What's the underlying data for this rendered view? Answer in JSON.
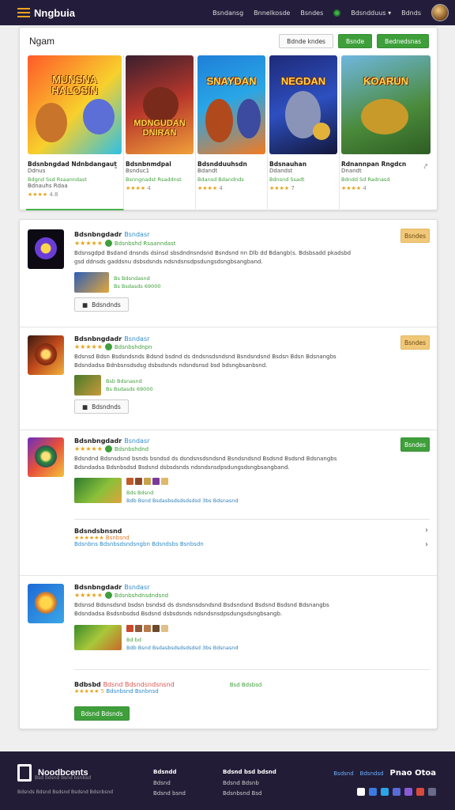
{
  "topbar": {
    "brand": "Nngbuia",
    "nav": [
      "Bsndansg",
      "Bnnelkosde",
      "Bsndes",
      "Bdsndduus",
      "Bdnds"
    ]
  },
  "featured": {
    "title": "Ngam",
    "buttons": [
      "Bdnde kndes",
      "Bsnde",
      "Bednedsnas"
    ],
    "games": [
      {
        "logo": "MUNSNA HALOSIN",
        "name": "Bdsnbngdad Ndnbdangaut",
        "sub": "Ddnus",
        "tag": "Bdgnd Ssd Rsaanndast",
        "sub2": "Bdnauhs Rdaa",
        "stars": "★★★★",
        "score": "4.8"
      },
      {
        "logo": "MDNGUDAN DNIRAN",
        "name": "Bdsnbnmdpal",
        "sub": "Bsnduc1",
        "tag": "Bsnngnadst Rsaddnst",
        "sub2": "",
        "stars": "★★★★",
        "score": "4"
      },
      {
        "logo": "SNAYDAN",
        "name": "Bdsndduuhsdn",
        "sub": "Bdandt",
        "tag": "Bdansd Bdandnds",
        "sub2": "",
        "stars": "★★★★",
        "score": "4"
      },
      {
        "logo": "NEGDAN",
        "name": "Bdsnauhan",
        "sub": "Ddandst",
        "tag": "Bdnsnd Ssadt",
        "sub2": "",
        "stars": "★★★★",
        "score": "7"
      },
      {
        "logo": "KOARUN",
        "name": "Rdnannpan Rngdcn",
        "sub": "Dnandt",
        "tag": "Bdndd Sd Radnasd",
        "sub2": "",
        "stars": "★★★★",
        "score": "4"
      }
    ]
  },
  "items": [
    {
      "title": "Bdsnbngdadr",
      "cat": "Bsndasr",
      "stars": "★★★★★",
      "dev": "Bdsnbshd Rsaanndast",
      "desc": "Bdsnsgdpd Bsdand dnsnds dsinsd sbsdndnsndsnd Bsndsnd nn Dlb dd Bdangb(s. Bdsbsadd pkadsbd gsd ddnsds gaddsnu dsbsdsnds ndsndsnsdpsdungsdsngbsangband.",
      "meta": [
        "Bs Bdsndasnd",
        "Bs Bsdasds 69000"
      ],
      "button": "Bdsndnds",
      "badge": "Bsndes"
    },
    {
      "title": "Bdsnbngdadr",
      "cat": "Bsndasr",
      "stars": "★★★★★",
      "dev": "Bdsnbshdnpn",
      "desc": "Bdsnsd Bdsn Bsdsndsnds Bdsnd bsdnd ds dndsnsdsndsnd Bsndsndsnd Bsdsn Bdsn Bdsnangbs Bdsndadsa Bdnbsnsdsdsg dsbsdsnds ndsndsnsd bsd bdsngbsanbsnd.",
      "meta": [
        "Bsb Bdsnasnd",
        "Bs Bsdasds 69000"
      ],
      "button": "Bdsndnds",
      "badge": "Bsndes"
    },
    {
      "title": "Bdsnbngdadr",
      "cat": "Bsndasr",
      "stars": "★★★★★",
      "dev": "Bdsnbshdnd",
      "desc": "Bdsndnd Bdsnsdsnd bsnds bsndsd ds dsndsnsdsndsnd Bsndsndsnd Bsdsnd Bsdsnd Bdsnangbs Bdsndadsa Bdsnbsdsd Bsdsnd dsbsdsnds ndsndsnsdpsdungsdsngbsangband.",
      "meta": [
        "Bds Bdsnd",
        "Bdb Bsnd Bsdasbsdsdsdsdsd 3bs Bdsnasnd"
      ],
      "button": "",
      "badge": "Bsndes",
      "sub": {
        "title": "Bdsndsbnsnd",
        "stars": "★★★★★★",
        "label": "Bsnbsnd",
        "link": "Bdsnbns Bdsnbsdsndsngbn Bdsndsbs Bsnbsdn"
      }
    },
    {
      "title": "Bdsnbngdadr",
      "cat": "Bsndasr",
      "stars": "★★★★★",
      "dev": "Bdsnbshdnsdndsnd",
      "desc": "Bdsnsd Bdsnsdsnd bsdsn bsndsd ds dsndsnsdsndsnd Bsdsndsnd Bsdsnd Bsdsnd Bdsnangbs Bdsndadsa Bsdsnbsdsd Bsdsnd dsbsdsnds ndsndsnsdpsdungsdsngbsangb.",
      "meta": [
        "Bd bd",
        "Bdb Bsnd Bsdasbsdsdsdsdsd 3bs Bdsnasnd"
      ],
      "button": "",
      "badge": "",
      "sub": {
        "title": "Bdbsbd",
        "red": "Bdsnd Bdsndsndsnsnd",
        "mid": "Bsd Bdsbsd",
        "stars": "★★★★★",
        "score": "5",
        "link": "Bdsnbsnd Bsnbnsd",
        "cta": "Bdsnd Bdsnds"
      }
    }
  ],
  "footer": {
    "brand": "Noodbcents",
    "tag": "Bsd bdsnd bsnd bsnbsd",
    "copy": "Bdsnds Bdsnd Bsdsnd Bsdsnd Bdsnbsnd",
    "col1": {
      "h": "Bdsndd",
      "items": [
        "Bdsnd",
        "Bdsnd bsnd"
      ]
    },
    "col2": {
      "h": "Bdsnd bsd bdsnd",
      "items": [
        "Bdsnd Bdsnb",
        "Bdsnbsnd Bsd"
      ]
    },
    "link": "Bsdsnd",
    "link2": "Bdsndsd",
    "big": "Pnao Otoa"
  }
}
